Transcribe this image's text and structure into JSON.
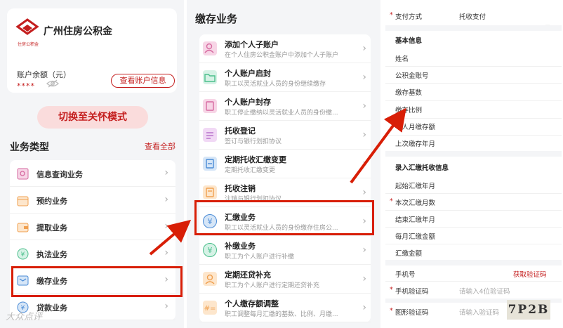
{
  "panel1": {
    "org_name": "广州住房公积金",
    "logo_caption": "住房公积金",
    "balance_label": "账户余额（元）",
    "balance_mask": "****",
    "view_account_label": "查看账户信息",
    "care_mode_label": "切换至关怀模式",
    "business_title": "业务类型",
    "view_all_label": "查看全部",
    "items": [
      {
        "label": "信息查询业务",
        "icon": "query-icon"
      },
      {
        "label": "预约业务",
        "icon": "calendar-icon"
      },
      {
        "label": "提取业务",
        "icon": "wallet-icon"
      },
      {
        "label": "执法业务",
        "icon": "law-icon"
      },
      {
        "label": "缴存业务",
        "icon": "deposit-icon"
      },
      {
        "label": "贷款业务",
        "icon": "loan-icon"
      }
    ],
    "watermark": "大众点评"
  },
  "panel2": {
    "title": "缴存业务",
    "items": [
      {
        "title": "添加个人子账户",
        "desc": "在个人住房公积金账户中添加个人子账户"
      },
      {
        "title": "个人账户启封",
        "desc": "职工以灵活就业人员的身份继续缴存"
      },
      {
        "title": "个人账户封存",
        "desc": "职工停止缴纳以灵活就业人员的身份缴..."
      },
      {
        "title": "托收登记",
        "desc": "签订与银行划扣协议"
      },
      {
        "title": "定期托收汇缴变更",
        "desc": "定期托收汇缴变更"
      },
      {
        "title": "托收注销",
        "desc": "注销与银行划扣协议"
      },
      {
        "title": "汇缴业务",
        "desc": "职工以灵活就业人员的身份缴存住房公..."
      },
      {
        "title": "补缴业务",
        "desc": "职工为个人账户进行补缴"
      },
      {
        "title": "定期还贷补充",
        "desc": "职工为个人账户进行定期还贷补充"
      },
      {
        "title": "个人缴存额调整",
        "desc": "职工调整每月汇缴的基数、比例、月缴..."
      }
    ]
  },
  "panel3": {
    "payment_method_label": "支付方式",
    "payment_method_value": "托收支付",
    "basic_info_title": "基本信息",
    "basic_fields": [
      "姓名",
      "公积金账号",
      "缴存基数",
      "缴存比例",
      "个人月缴存额",
      "上次缴存年月"
    ],
    "remit_title": "录入汇缴托收信息",
    "remit_fields": [
      "起始汇缴年月",
      "本次汇缴月数",
      "结束汇缴年月",
      "每月汇缴金额",
      "汇缴金额"
    ],
    "phone_label": "手机号",
    "get_code_label": "获取验证码",
    "sms_code_label": "手机验证码",
    "sms_code_placeholder": "请输入4位验证码",
    "captcha_label": "图形验证码",
    "captcha_placeholder": "请输入验证码",
    "captcha_text": "7P2B"
  },
  "colors": {
    "accent": "#c41e1e",
    "highlight": "#d81e06",
    "background": "#f4f5f7"
  }
}
